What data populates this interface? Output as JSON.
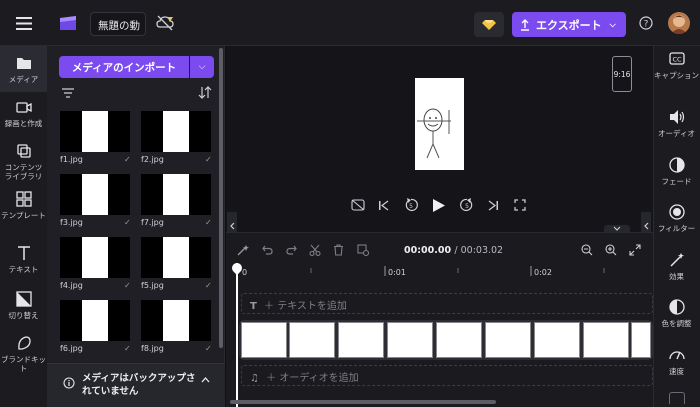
{
  "app": {
    "project_title": "無題の動",
    "export_label": "エクスポート",
    "menu_icon": "hamburger-icon",
    "logo_icon": "clipchamp-logo",
    "colors": {
      "accent": "#7b4bf0",
      "background": "#0f0f14",
      "panel": "#1f1f25",
      "premium": "#f5c542"
    }
  },
  "left_rail": {
    "items": [
      {
        "label": "メディア",
        "icon": "folder-icon"
      },
      {
        "label": "録画と作成",
        "icon": "camera-icon"
      },
      {
        "label": "コンテンツ ライブラリ",
        "icon": "library-icon"
      },
      {
        "label": "テンプレート",
        "icon": "template-icon"
      },
      {
        "label": "テキスト",
        "icon": "text-icon"
      },
      {
        "label": "切り替え",
        "icon": "transition-icon"
      },
      {
        "label": "ブランドキット",
        "icon": "brand-kit-icon"
      }
    ]
  },
  "media_panel": {
    "import_label": "メディアのインポート",
    "files": [
      {
        "name": "f1.jpg"
      },
      {
        "name": "f2.jpg"
      },
      {
        "name": "f3.jpg"
      },
      {
        "name": "f7.jpg"
      },
      {
        "name": "f4.jpg"
      },
      {
        "name": "f5.jpg"
      },
      {
        "name": "f6.jpg"
      },
      {
        "name": "f8.jpg"
      }
    ],
    "backup_notice": "メディアはバックアップされていません"
  },
  "preview": {
    "aspect_ratio": "9:16"
  },
  "timeline": {
    "current_time": "00:00.00",
    "total_time": "/ 00:03.02",
    "ruler": [
      "0",
      "0:01",
      "0:02"
    ],
    "add_text_label": "＋ テキストを追加",
    "add_audio_label": "＋ オーディオを追加"
  },
  "right_rail": {
    "items": [
      {
        "label": "キャプション",
        "icon": "captions-icon"
      },
      {
        "label": "オーディオ",
        "icon": "speaker-icon"
      },
      {
        "label": "フェード",
        "icon": "fade-icon"
      },
      {
        "label": "フィルター",
        "icon": "filter-icon"
      },
      {
        "label": "効果",
        "icon": "effects-wand-icon"
      },
      {
        "label": "色を調整",
        "icon": "color-adjust-icon"
      },
      {
        "label": "速度",
        "icon": "speed-gauge-icon"
      }
    ]
  }
}
